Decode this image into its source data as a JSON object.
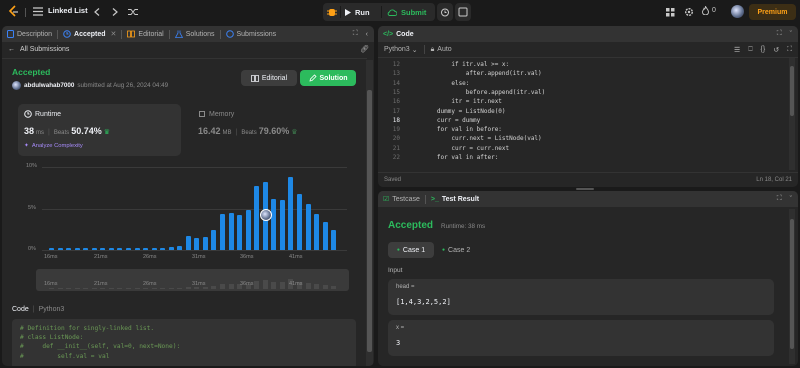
{
  "topbar": {
    "logo": "leetcode-logo",
    "problem_list_label": "Linked List",
    "run_label": "Run",
    "submit_label": "Submit",
    "streak_count": "0",
    "premium_label": "Premium"
  },
  "left": {
    "tabs": [
      "Description",
      "Accepted",
      "Editorial",
      "Solutions",
      "Submissions"
    ],
    "back_label": "All Submissions",
    "status": "Accepted",
    "user": "abdulwahab7000",
    "submitted_text": "submitted at Aug 26, 2024 04:49",
    "editorial_btn": "Editorial",
    "solution_btn": "Solution",
    "runtime": {
      "title": "Runtime",
      "value": "38",
      "unit": "ms",
      "beats_label": "Beats",
      "beats_value": "50.74%",
      "analyze_label": "Analyze Complexity"
    },
    "memory": {
      "title": "Memory",
      "value": "16.42",
      "unit": "MB",
      "beats_label": "Beats",
      "beats_value": "79.60%"
    },
    "code_label": "Code",
    "code_lang": "Python3",
    "code_lines": [
      "# Definition for singly-linked list.",
      "# class ListNode:",
      "#     def __init__(self, val=0, next=None):",
      "#         self.val = val"
    ]
  },
  "chart_data": {
    "type": "bar",
    "y_ticks": [
      "10%",
      "5%",
      "0%"
    ],
    "x_ticks": [
      "16ms",
      "21ms",
      "26ms",
      "31ms",
      "36ms",
      "41ms"
    ],
    "ylim": [
      0,
      10
    ],
    "values": [
      0.3,
      0.3,
      0.3,
      0.3,
      0.3,
      0.3,
      0.3,
      0.3,
      0.3,
      0.3,
      0.3,
      0.3,
      0.3,
      0.3,
      0.4,
      0.5,
      1.7,
      1.4,
      1.6,
      2.4,
      4.3,
      4.4,
      4.2,
      4.8,
      7.7,
      8.2,
      6.1,
      6.0,
      8.8,
      6.7,
      5.6,
      4.3,
      3.4,
      2.4
    ],
    "highlight_index": 26,
    "color": "#1e88e5"
  },
  "right": {
    "code_tab": "Code",
    "lang": "Python3",
    "auto_label": "Auto",
    "editor_lines": [
      {
        "n": "12",
        "t": "            if itr.val >= x:"
      },
      {
        "n": "13",
        "t": "                after.append(itr.val)"
      },
      {
        "n": "14",
        "t": "            else:"
      },
      {
        "n": "15",
        "t": "                before.append(itr.val)"
      },
      {
        "n": "16",
        "t": "            itr = itr.next"
      },
      {
        "n": "17",
        "t": "        dummy = ListNode(0)"
      },
      {
        "n": "18",
        "t": "        curr = dummy"
      },
      {
        "n": "19",
        "t": "        for val in before:"
      },
      {
        "n": "20",
        "t": "            curr.next = ListNode(val)"
      },
      {
        "n": "21",
        "t": "            curr = curr.next"
      },
      {
        "n": "22",
        "t": "        for val in after:"
      }
    ],
    "saved_label": "Saved",
    "cursor_pos": "Ln 18, Col 21",
    "testcase_tab": "Testcase",
    "result_tab": "Test Result",
    "result_status": "Accepted",
    "result_runtime": "Runtime: 38 ms",
    "case1": "Case 1",
    "case2": "Case 2",
    "input_label": "Input",
    "head_label": "head =",
    "head_value": "[1,4,3,2,5,2]",
    "x_label": "x =",
    "x_value": "3"
  }
}
